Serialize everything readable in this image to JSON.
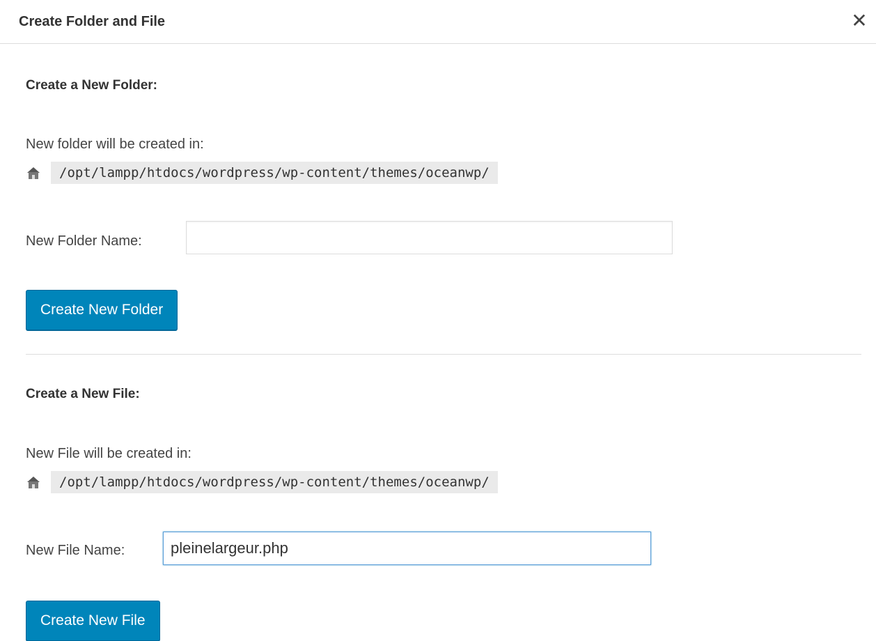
{
  "dialog": {
    "title": "Create Folder and File"
  },
  "folder_section": {
    "heading": "Create a New Folder:",
    "location_label": "New folder will be created in:",
    "path": "/opt/lampp/htdocs/wordpress/wp-content/themes/oceanwp/",
    "name_label": "New Folder Name:",
    "name_value": "",
    "button_label": "Create New Folder"
  },
  "file_section": {
    "heading": "Create a New File:",
    "location_label": "New File will be created in:",
    "path": "/opt/lampp/htdocs/wordpress/wp-content/themes/oceanwp/",
    "name_label": "New File Name:",
    "name_value": "pleinelargeur.php",
    "button_label": "Create New File"
  },
  "colors": {
    "button_bg": "#0085ba",
    "path_bg": "#eaeaea",
    "focus_border": "#5b9dd9"
  },
  "icons": {
    "close": "close-icon",
    "path": "home-folder-icon"
  }
}
